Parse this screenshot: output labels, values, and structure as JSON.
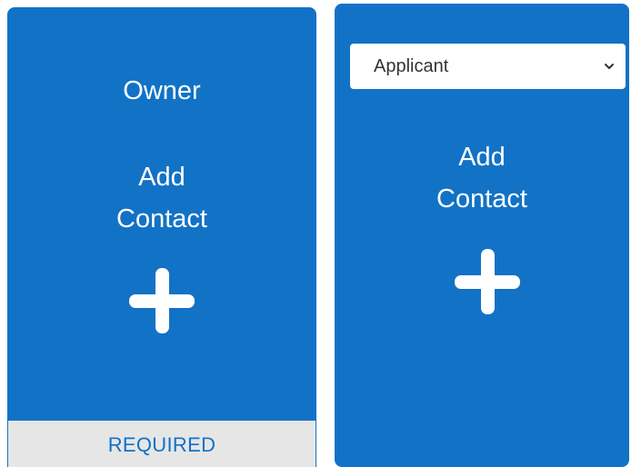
{
  "owner_card": {
    "role_label": "Owner",
    "add_line1": "Add",
    "add_line2": "Contact",
    "plus_icon": "plus-icon",
    "required_label": "REQUIRED"
  },
  "applicant_card": {
    "role_select": {
      "selected": "Applicant",
      "chevron_icon": "chevron-down-icon"
    },
    "add_line1": "Add",
    "add_line2": "Contact",
    "plus_icon": "plus-icon"
  },
  "colors": {
    "card_blue": "#1272c6",
    "footer_gray": "#e6e6e6",
    "text_white": "#ffffff"
  }
}
